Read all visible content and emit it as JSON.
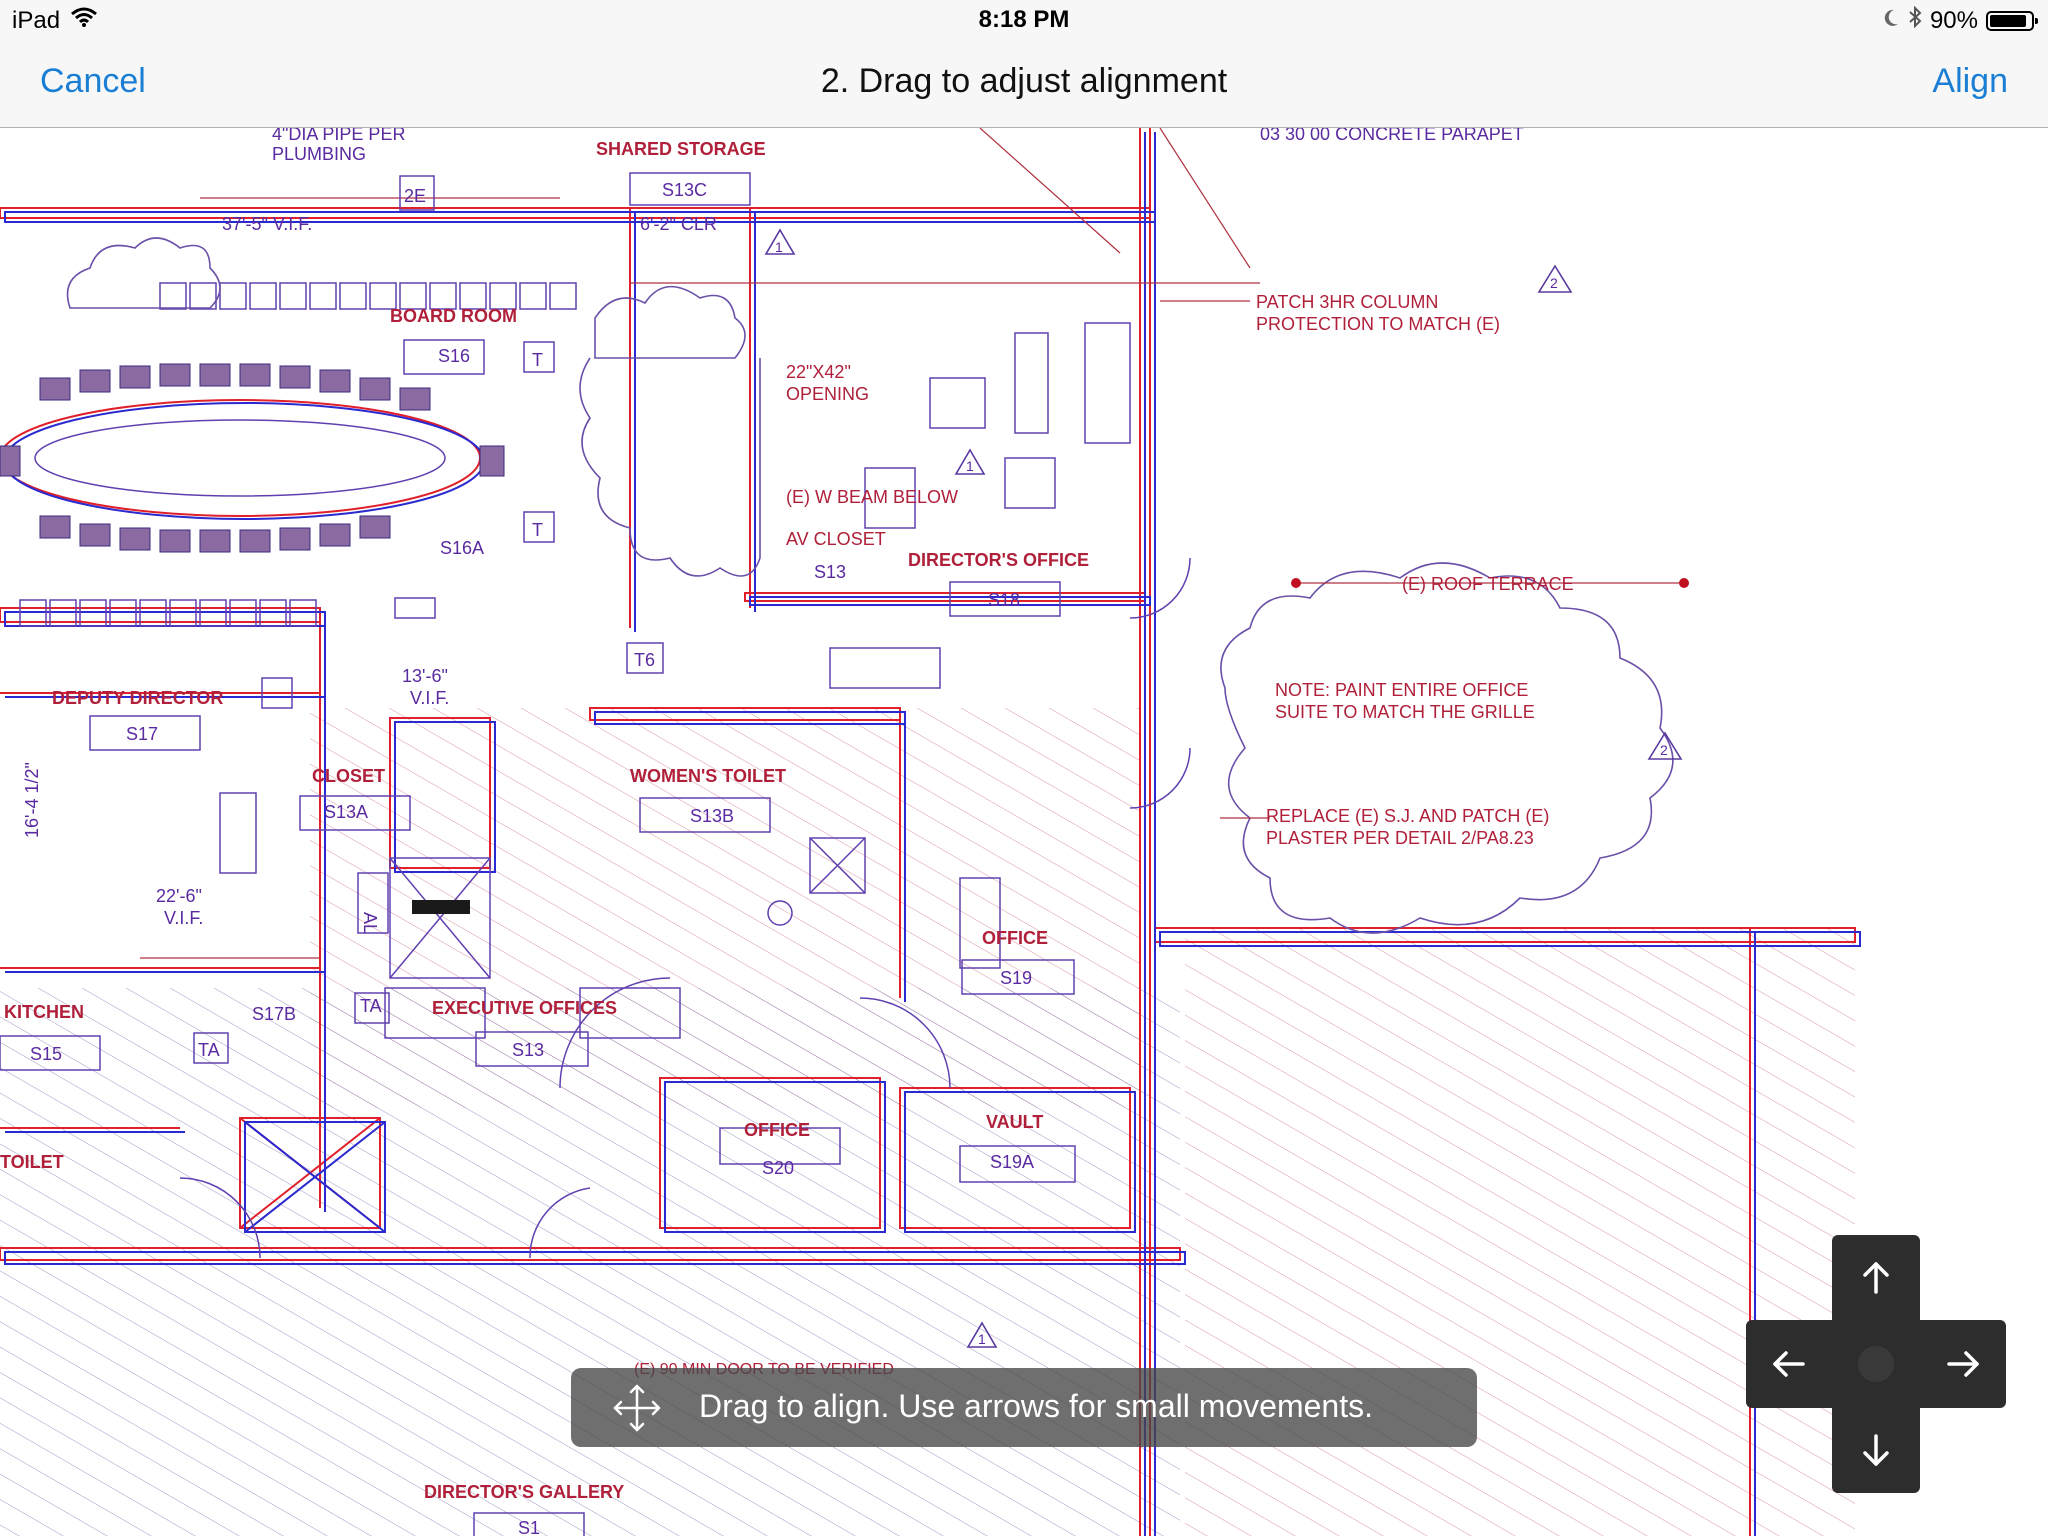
{
  "status_bar": {
    "device": "iPad",
    "time": "8:18 PM",
    "battery": "90%",
    "battery_level": 0.9,
    "icons": [
      "wifi-icon",
      "moon-icon",
      "bluetooth-icon",
      "battery-icon"
    ]
  },
  "nav": {
    "cancel_label": "Cancel",
    "title": "2. Drag to adjust alignment",
    "align_label": "Align"
  },
  "hint": {
    "text": "Drag to align. Use arrows for small movements.",
    "icon": "move-icon"
  },
  "arrow_pad": {
    "icons": [
      "arrow-up-icon",
      "arrow-left-icon",
      "arrow-right-icon",
      "arrow-down-icon"
    ]
  },
  "colors": {
    "accent": "#1a7fd4",
    "overlay_red": "#e0202a",
    "overlay_blue": "#2a2ad0"
  },
  "drawing": {
    "labels": {
      "pipe": "4\"DIA PIPE PER",
      "plumbing": "PLUMBING",
      "shared_storage": "SHARED STORAGE",
      "s13c": "S13C",
      "clr": "6'-2\" CLR",
      "tag_2e": "2E",
      "dim_37": "37'-5\" V.I.F.",
      "parapet": "03 30 00 CONCRETE PARAPET",
      "patch1": "PATCH 3HR COLUMN",
      "patch2": "PROTECTION TO MATCH (E)",
      "board_room": "BOARD ROOM",
      "s16": "S16",
      "opening1": "22\"X42\"",
      "opening2": "OPENING",
      "wbeam": "(E) W BEAM BELOW",
      "av_closet": "AV CLOSET",
      "directors_office": "DIRECTOR'S OFFICE",
      "s13": "S13",
      "s18": "S18",
      "s16a": "S16A",
      "roof_terrace": "(E) ROOF TERRACE",
      "note1": "NOTE: PAINT ENTIRE OFFICE",
      "note2": "SUITE TO MATCH THE GRILLE",
      "replace1": "REPLACE (E) S.J. AND PATCH (E)",
      "replace2": "PLASTER PER DETAIL 2/PA8.23",
      "deputy_director": "DEPUTY DIRECTOR",
      "s17": "S17",
      "dim_13": "13'-6\"",
      "vif": "V.I.F.",
      "closet": "CLOSET",
      "s13a": "S13A",
      "womens_toilet": "WOMEN'S TOILET",
      "s13b": "S13B",
      "dim_16": "16'-4 1/2\"",
      "dim_22": "22'-6\"",
      "vif2": "V.I.F.",
      "office1": "OFFICE",
      "s19": "S19",
      "kitchen": "KITCHEN",
      "s15": "S15",
      "s17b": "S17B",
      "exec_offices": "EXECUTIVE OFFICES",
      "s13_2": "S13",
      "office2": "OFFICE",
      "s20": "S20",
      "vault": "VAULT",
      "s19a": "S19A",
      "toilet": "TOILET",
      "door_note": "(E) 90 MIN DOOR TO BE VERIFIED",
      "directors_gallery": "DIRECTOR'S GALLERY",
      "s1": "S1",
      "ta1": "TA",
      "ta2": "TA",
      "t1": "T",
      "t2": "T",
      "t6": "T6",
      "al": "AL",
      "rev1": "1",
      "rev2": "2",
      "rev3": "1",
      "rev4": "2",
      "rev5": "1"
    }
  }
}
